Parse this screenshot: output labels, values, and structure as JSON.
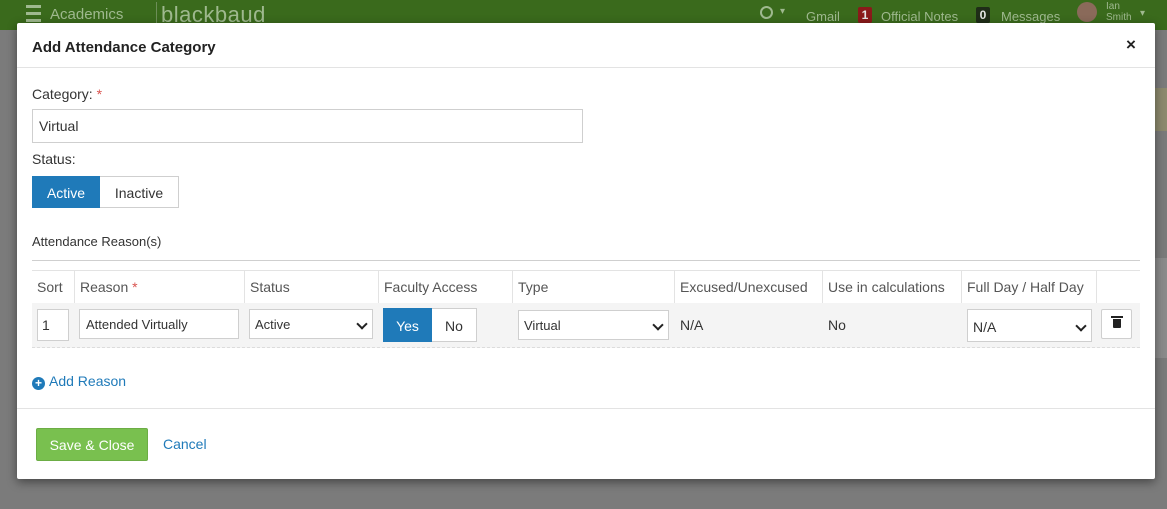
{
  "background": {
    "app_name": "Academics",
    "brand": "blackbaud",
    "gmail": "Gmail",
    "notes_count": "1",
    "notes_label": "Official Notes",
    "messages_count": "0",
    "messages_label": "Messages",
    "user_first": "Ian",
    "user_last": "Smith"
  },
  "modal": {
    "title": "Add Attendance Category",
    "close_symbol": "×",
    "category_label": "Category:",
    "required_mark": "*",
    "category_value": "Virtual",
    "status_label": "Status:",
    "status_options": [
      "Active",
      "Inactive"
    ],
    "status_selected": "Active",
    "reasons_label": "Attendance Reason(s)",
    "add_reason": "Add Reason",
    "save_label": "Save & Close",
    "cancel_label": "Cancel"
  },
  "table": {
    "headers": [
      "Sort",
      "Reason",
      "Status",
      "Faculty Access",
      "Type",
      "Excused/Unexcused",
      "Use in calculations",
      "Full Day / Half Day"
    ],
    "rows": [
      {
        "sort": "1",
        "reason": "Attended Virtually",
        "status": "Active",
        "faculty_access_options": [
          "Yes",
          "No"
        ],
        "faculty_access_selected": "Yes",
        "type": "Virtual",
        "excused": "N/A",
        "use_in_calculations": "No",
        "full_half_day": "N/A"
      }
    ]
  },
  "colors": {
    "accent_blue": "#1f7ab9",
    "save_green": "#79c04f",
    "required_red": "#d9534f",
    "header_green": "#3a6a1c"
  },
  "icons": [
    "menu-icon",
    "search-icon",
    "avatar",
    "close-icon",
    "plus-circle-icon",
    "trash-icon",
    "chevron-down-icon"
  ]
}
